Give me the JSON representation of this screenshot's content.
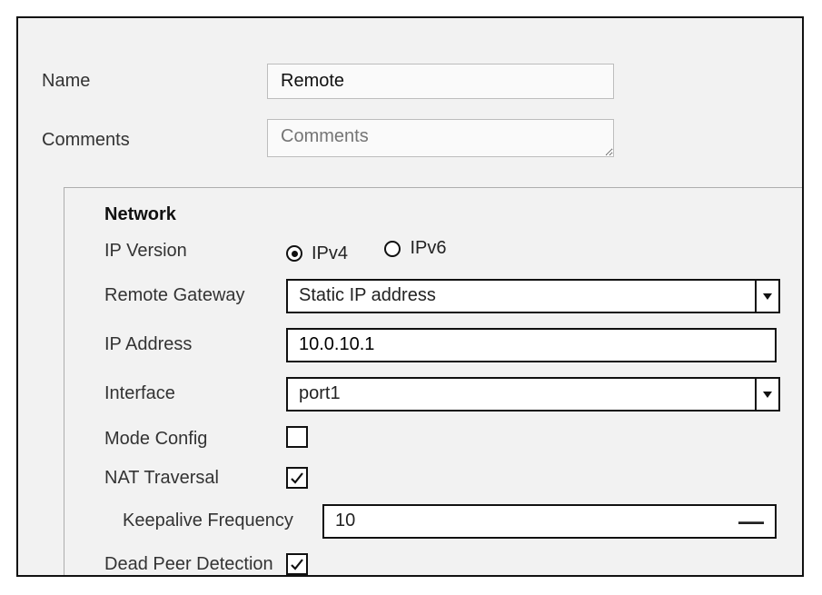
{
  "header": {
    "name_label": "Name",
    "name_value": "Remote",
    "comments_label": "Comments",
    "comments_placeholder": "Comments",
    "comments_value": ""
  },
  "network": {
    "section_title": "Network",
    "ip_version_label": "IP Version",
    "ip_version_options": {
      "ipv4": "IPv4",
      "ipv6": "IPv6"
    },
    "ip_version_selected": "ipv4",
    "remote_gateway_label": "Remote Gateway",
    "remote_gateway_value": "Static IP address",
    "ip_address_label": "IP Address",
    "ip_address_value": "10.0.10.1",
    "interface_label": "Interface",
    "interface_value": "port1",
    "mode_config_label": "Mode Config",
    "mode_config_checked": false,
    "nat_traversal_label": "NAT Traversal",
    "nat_traversal_checked": true,
    "keepalive_label": "Keepalive Frequency",
    "keepalive_value": "10",
    "dpd_label": "Dead Peer Detection",
    "dpd_checked": true
  }
}
